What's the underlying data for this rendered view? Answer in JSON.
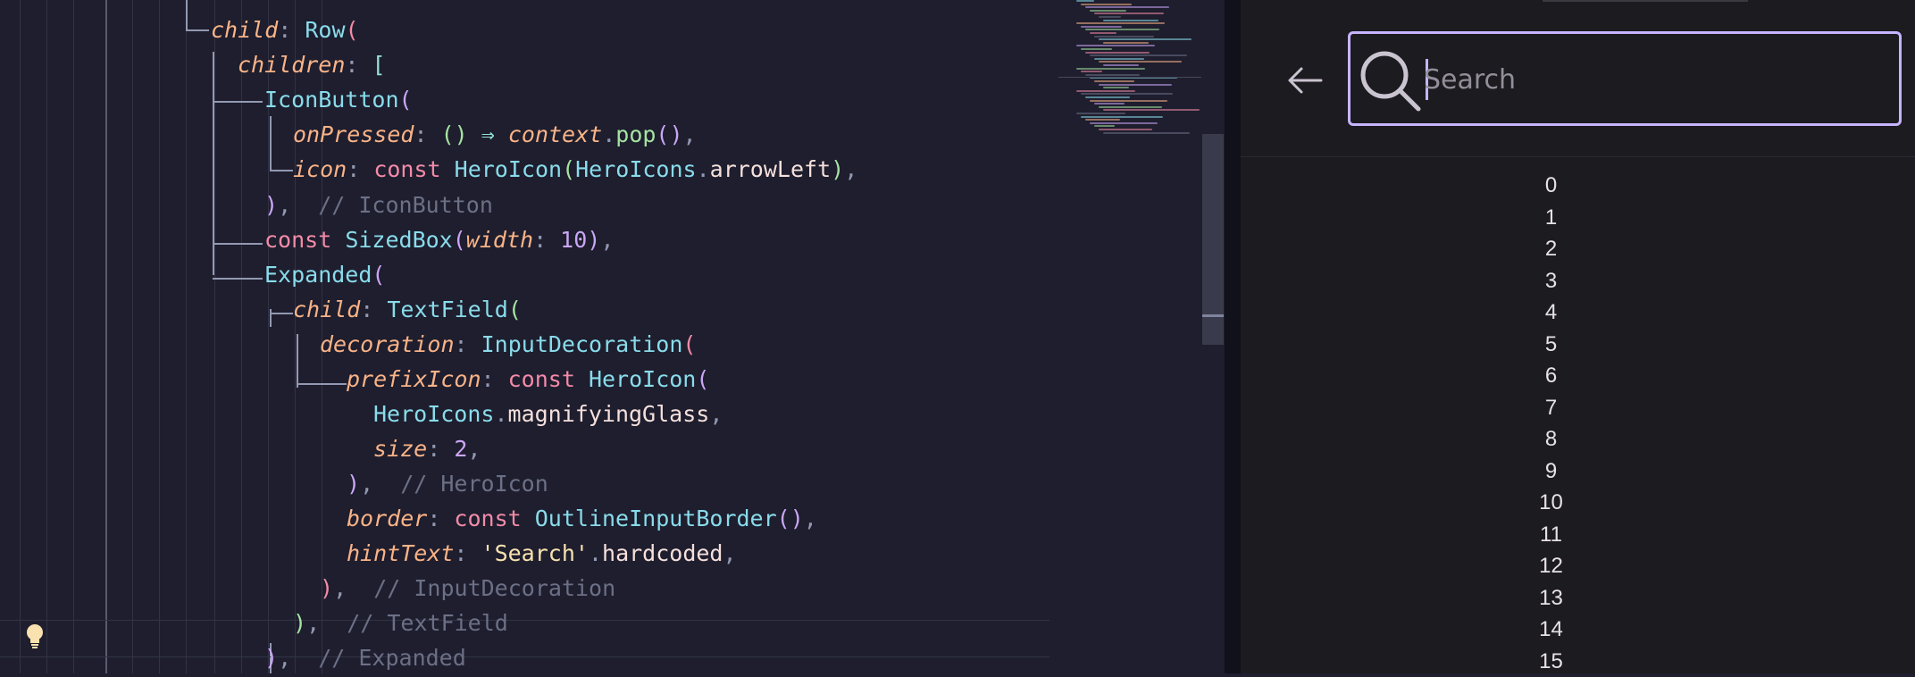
{
  "editor": {
    "lines": [
      [
        [
          "t-param",
          "child"
        ],
        [
          "t-punct",
          ": "
        ],
        [
          "t-cls",
          "Row"
        ],
        [
          "t-br1",
          "("
        ]
      ],
      [
        [
          "t-param",
          "children"
        ],
        [
          "t-punct",
          ": "
        ],
        [
          "t-op",
          "["
        ]
      ],
      [
        [
          "t-cls",
          "IconButton"
        ],
        [
          "t-br2",
          "("
        ]
      ],
      [
        [
          "t-param",
          "onPressed"
        ],
        [
          "t-punct",
          ": "
        ],
        [
          "t-br3",
          "() "
        ],
        [
          "t-op",
          "⇒ "
        ],
        [
          "t-ctx",
          "context"
        ],
        [
          "t-punct",
          "."
        ],
        [
          "t-fn",
          "pop"
        ],
        [
          "t-br2",
          "()"
        ],
        [
          "t-punct",
          ","
        ]
      ],
      [
        [
          "t-param",
          "icon"
        ],
        [
          "t-punct",
          ": "
        ],
        [
          "t-kw",
          "const "
        ],
        [
          "t-cls",
          "HeroIcon"
        ],
        [
          "t-br3",
          "("
        ],
        [
          "t-cls",
          "HeroIcons"
        ],
        [
          "t-punct",
          "."
        ],
        [
          "t-id",
          "arrowLeft"
        ],
        [
          "t-br3",
          ")"
        ],
        [
          "t-punct",
          ","
        ]
      ],
      [
        [
          "t-br2",
          ")"
        ],
        [
          "t-punct",
          ", "
        ],
        [
          "t-cmt",
          " // IconButton"
        ]
      ],
      [
        [
          "t-kw",
          "const "
        ],
        [
          "t-cls",
          "SizedBox"
        ],
        [
          "t-br2",
          "("
        ],
        [
          "t-param",
          "width"
        ],
        [
          "t-punct",
          ": "
        ],
        [
          "t-num",
          "10"
        ],
        [
          "t-br2",
          ")"
        ],
        [
          "t-punct",
          ","
        ]
      ],
      [
        [
          "t-cls",
          "Expanded"
        ],
        [
          "t-br2",
          "("
        ]
      ],
      [
        [
          "t-param",
          "child"
        ],
        [
          "t-punct",
          ": "
        ],
        [
          "t-cls",
          "TextField"
        ],
        [
          "t-br3",
          "("
        ]
      ],
      [
        [
          "t-param",
          "decoration"
        ],
        [
          "t-punct",
          ": "
        ],
        [
          "t-cls",
          "InputDecoration"
        ],
        [
          "t-br1",
          "("
        ]
      ],
      [
        [
          "t-param",
          "prefixIcon"
        ],
        [
          "t-punct",
          ": "
        ],
        [
          "t-kw",
          "const "
        ],
        [
          "t-cls",
          "HeroIcon"
        ],
        [
          "t-br2",
          "("
        ]
      ],
      [
        [
          "t-cls",
          "HeroIcons"
        ],
        [
          "t-punct",
          "."
        ],
        [
          "t-id",
          "magnifyingGlass"
        ],
        [
          "t-punct",
          ","
        ]
      ],
      [
        [
          "t-param",
          "size"
        ],
        [
          "t-punct",
          ": "
        ],
        [
          "t-num",
          "2"
        ],
        [
          "t-punct",
          ","
        ]
      ],
      [
        [
          "t-br2",
          ")"
        ],
        [
          "t-punct",
          ", "
        ],
        [
          "t-cmt",
          " // HeroIcon"
        ]
      ],
      [
        [
          "t-param",
          "border"
        ],
        [
          "t-punct",
          ": "
        ],
        [
          "t-kw",
          "const "
        ],
        [
          "t-cls",
          "OutlineInputBorder"
        ],
        [
          "t-br2",
          "()"
        ],
        [
          "t-punct",
          ","
        ]
      ],
      [
        [
          "t-param",
          "hintText"
        ],
        [
          "t-punct",
          ": "
        ],
        [
          "t-str",
          "'Search'"
        ],
        [
          "t-punct",
          "."
        ],
        [
          "t-id",
          "hardcoded"
        ],
        [
          "t-punct",
          ","
        ]
      ],
      [
        [
          "t-br1",
          ")"
        ],
        [
          "t-punct",
          ", "
        ],
        [
          "t-cmt",
          " // InputDecoration"
        ]
      ],
      [
        [
          "t-br3",
          ")"
        ],
        [
          "t-punct",
          ", "
        ],
        [
          "t-cmt",
          " // TextField"
        ]
      ],
      [
        [
          "t-br2",
          ")"
        ],
        [
          "t-punct",
          ", "
        ],
        [
          "t-cmt",
          " // Expanded"
        ]
      ]
    ]
  },
  "app": {
    "back_icon": "arrow-left-icon",
    "search_icon": "magnifying-glass-icon",
    "search": {
      "placeholder": "Search",
      "value": ""
    },
    "accent_color": "#c6b4ff",
    "items": [
      "0",
      "1",
      "2",
      "3",
      "4",
      "5",
      "6",
      "7",
      "8",
      "9",
      "10",
      "11",
      "12",
      "13",
      "14",
      "15"
    ]
  }
}
